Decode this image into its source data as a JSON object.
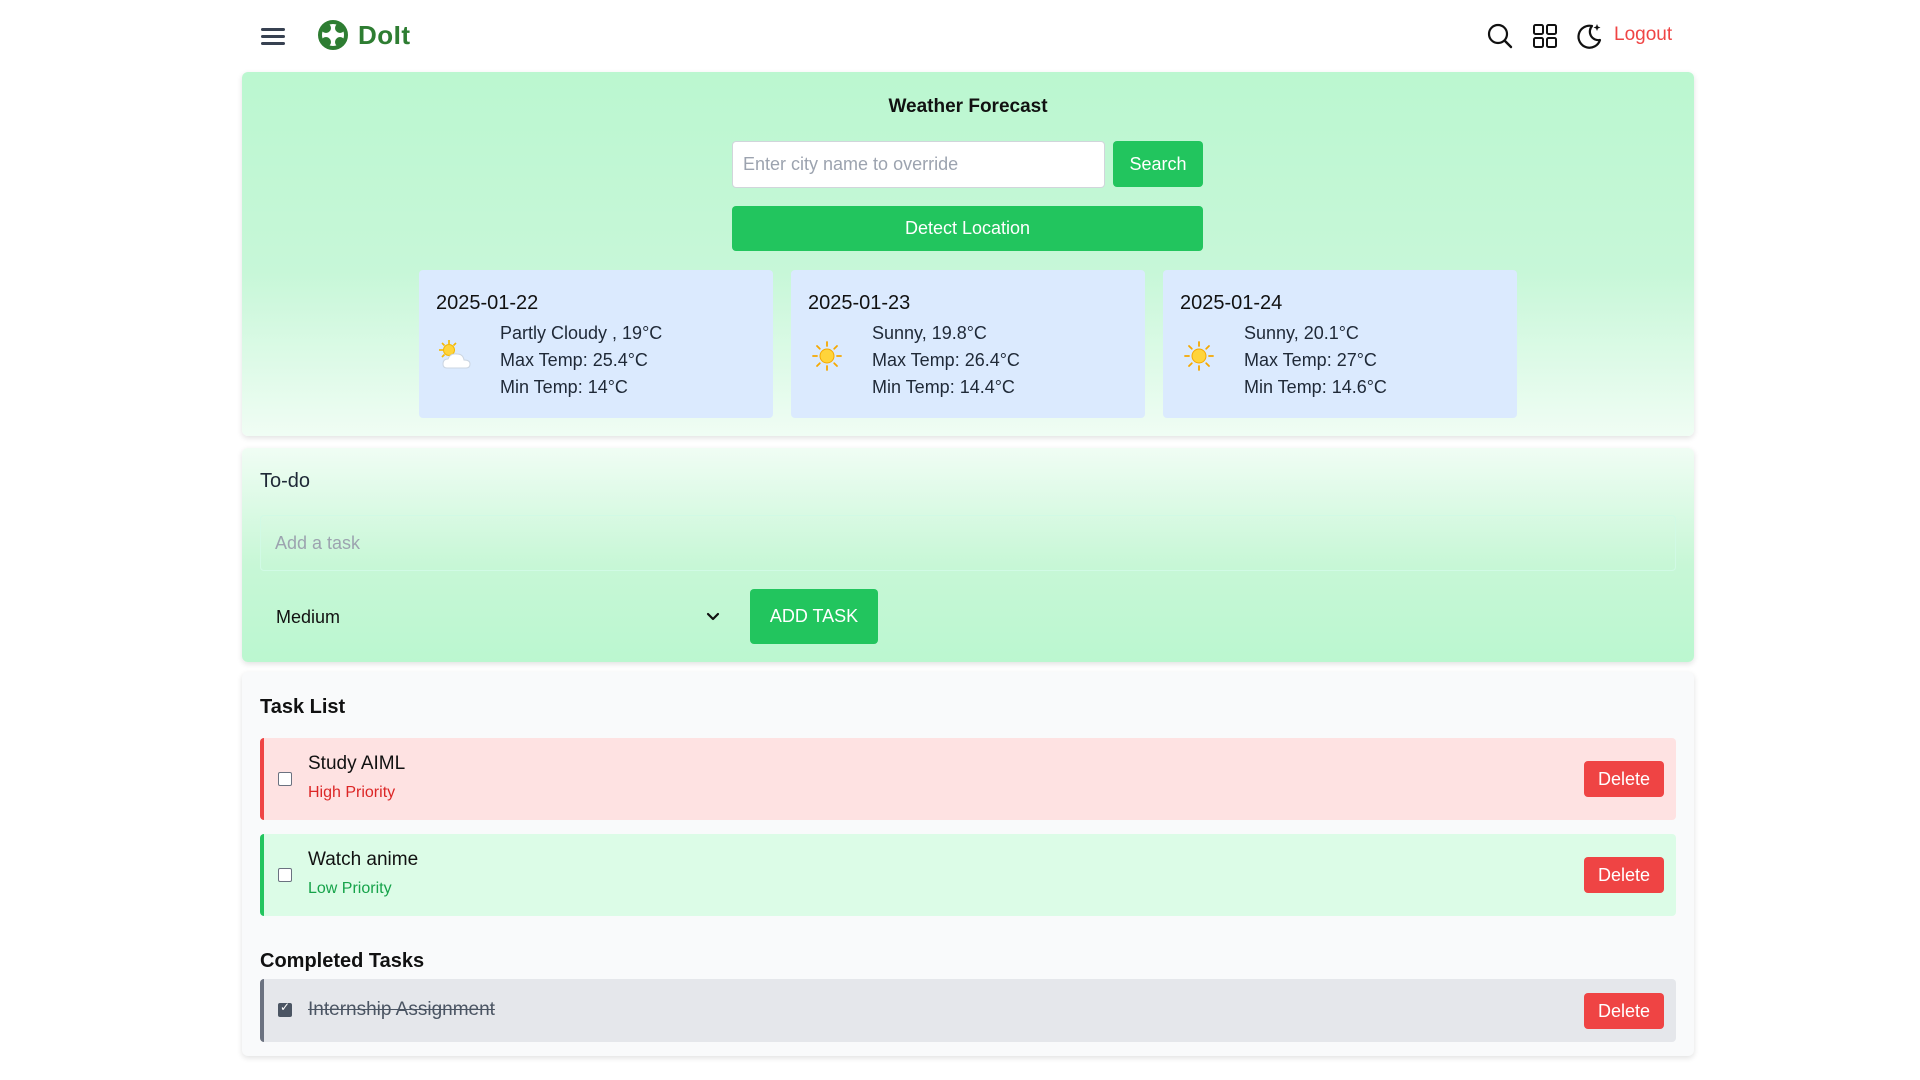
{
  "app": {
    "name": "DoIt"
  },
  "header": {
    "logout_label": "Logout"
  },
  "icons": {
    "menu": "hamburger-menu-icon",
    "logo": "doit-logo-icon",
    "search": "search-icon",
    "grid": "grid-view-icon",
    "theme": "moon-theme-icon"
  },
  "colors": {
    "brand": "#2e7d32",
    "accent_green": "#22c55e",
    "danger": "#ef4444",
    "forecast_card": "#dbeafe"
  },
  "weather": {
    "title": "Weather Forecast",
    "city_placeholder": "Enter city name to override",
    "search_label": "Search",
    "detect_label": "Detect Location",
    "forecasts": [
      {
        "date": "2025-01-22",
        "condition": "Partly Cloudy , 19°C",
        "max": "Max Temp: 25.4°C",
        "min": "Min Temp: 14°C",
        "icon": "partly-cloudy-icon"
      },
      {
        "date": "2025-01-23",
        "condition": "Sunny, 19.8°C",
        "max": "Max Temp: 26.4°C",
        "min": "Min Temp: 14.4°C",
        "icon": "sunny-icon"
      },
      {
        "date": "2025-01-24",
        "condition": "Sunny, 20.1°C",
        "max": "Max Temp: 27°C",
        "min": "Min Temp: 14.6°C",
        "icon": "sunny-icon"
      }
    ]
  },
  "todo": {
    "title": "To-do",
    "task_placeholder": "Add a task",
    "priority_selected": "Medium",
    "add_label": "ADD TASK"
  },
  "task_list": {
    "title": "Task List",
    "tasks": [
      {
        "name": "Study AIML",
        "priority": "High Priority",
        "delete_label": "Delete",
        "checked": false
      },
      {
        "name": "Watch anime",
        "priority": "Low Priority",
        "delete_label": "Delete",
        "checked": false
      }
    ]
  },
  "completed": {
    "title": "Completed Tasks",
    "tasks": [
      {
        "name": "Internship Assignment",
        "delete_label": "Delete",
        "checked": true
      }
    ]
  }
}
